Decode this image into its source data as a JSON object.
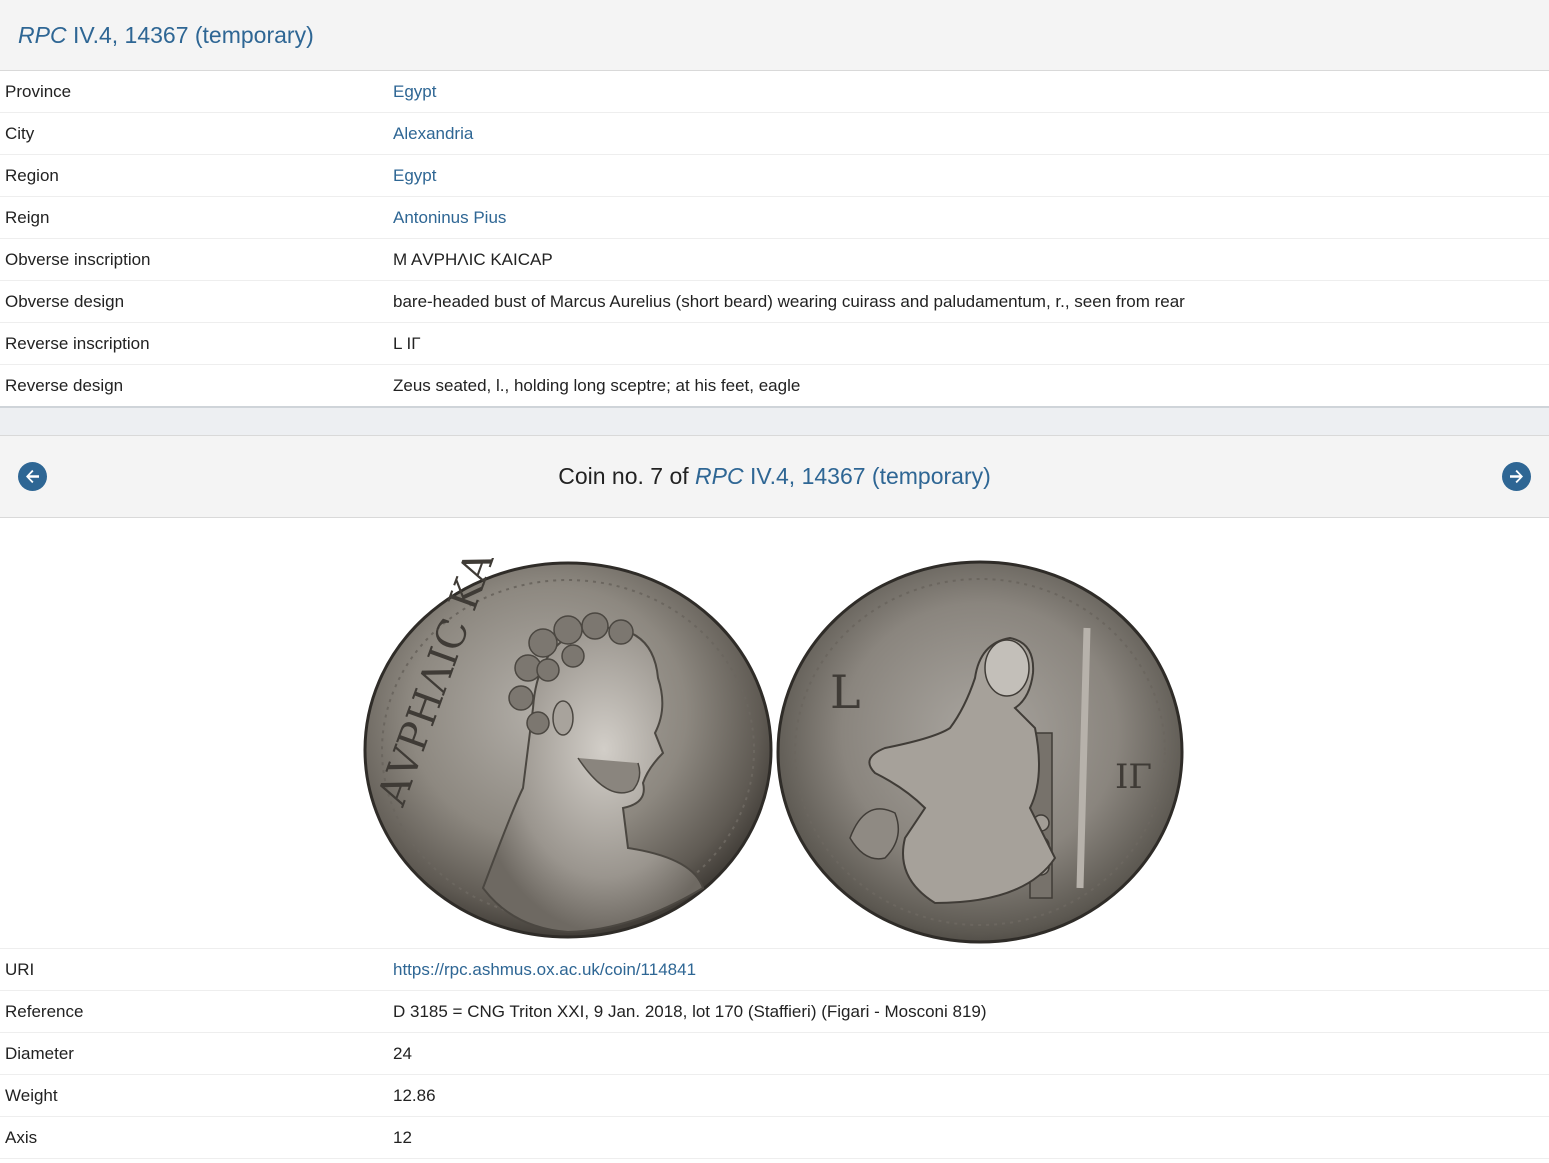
{
  "header": {
    "title_italic": "RPC",
    "title_rest": " IV.4, 14367 (temporary)"
  },
  "type_fields": [
    {
      "label": "Province",
      "value": "Egypt",
      "link": true
    },
    {
      "label": "City",
      "value": "Alexandria",
      "link": true
    },
    {
      "label": "Region",
      "value": "Egypt",
      "link": true
    },
    {
      "label": "Reign",
      "value": "Antoninus Pius",
      "link": true
    },
    {
      "label": "Obverse inscription",
      "value": "Μ ΑVΡΗΛΙϹ ΚΑΙϹΑΡ",
      "link": false
    },
    {
      "label": "Obverse design",
      "value": "bare-headed bust of Marcus Aurelius (short beard) wearing cuirass and paludamentum, r., seen from rear",
      "link": false
    },
    {
      "label": "Reverse inscription",
      "value": "L ΙΓ",
      "link": false
    },
    {
      "label": "Reverse design",
      "value": "Zeus seated, l., holding long sceptre; at his feet, eagle",
      "link": false
    }
  ],
  "coin_nav": {
    "prefix": "Coin no. 7 of ",
    "link_italic": "RPC",
    "link_rest": " IV.4, 14367 (temporary)",
    "prev_icon": "arrow-circle-left-icon",
    "next_icon": "arrow-circle-right-icon"
  },
  "coin_images": {
    "obverse": "coin-obverse-image",
    "reverse": "coin-reverse-image",
    "obverse_legend": "ΑVΡΗΛΙϹ ΚΑΙϹΑ",
    "reverse_legend_left": "L",
    "reverse_legend_right": "ΙΓ"
  },
  "coin_fields": [
    {
      "label": "URI",
      "value": "https://rpc.ashmus.ox.ac.uk/coin/114841",
      "link": true
    },
    {
      "label": "Reference",
      "value": "D 3185 = CNG Triton XXI, 9 Jan. 2018, lot 170 (Staffieri) (Figari - Mosconi 819)",
      "link": false
    },
    {
      "label": "Diameter",
      "value": "24",
      "link": false
    },
    {
      "label": "Weight",
      "value": "12.86",
      "link": false
    },
    {
      "label": "Axis",
      "value": "12",
      "link": false
    }
  ],
  "colors": {
    "link": "#2e6694",
    "header_bg": "#f4f4f4",
    "separator_bg": "#edeff2"
  }
}
